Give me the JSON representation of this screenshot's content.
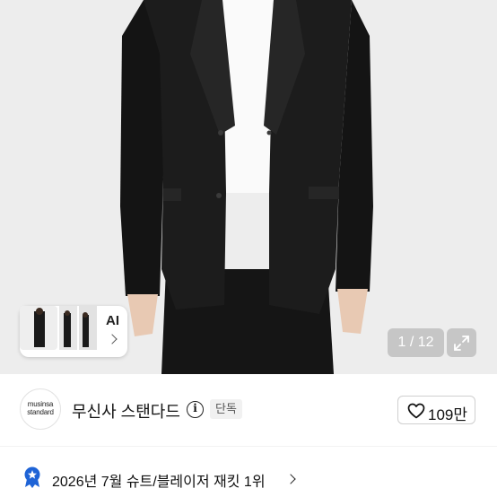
{
  "gallery": {
    "ai_label": "AI",
    "counter": "1 / 12"
  },
  "brand": {
    "logo_line1": "musinsa",
    "logo_line2": "standard",
    "name": "무신사 스탠다드",
    "info_symbol": "i",
    "exclusive_badge": "단독",
    "like_count": "109만"
  },
  "ranking": {
    "text": "2026년 7월 슈트/블레이저 재킷 1위"
  },
  "colors": {
    "hero_background": "#ececec",
    "jacket": "#1a1a1a",
    "rank_badge": "#1e63d6"
  },
  "icons": {
    "like": "heart-outline-icon",
    "expand": "expand-diagonal-icon",
    "info": "info-circle-icon",
    "rank": "ribbon-star-icon"
  }
}
